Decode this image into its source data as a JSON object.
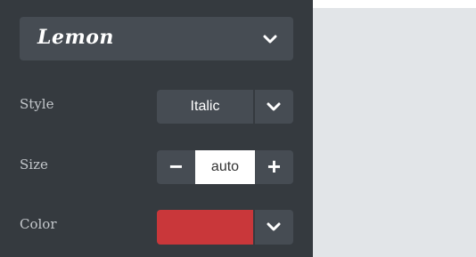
{
  "font_picker": {
    "value": "Lemon",
    "icon": "chevron-down-icon"
  },
  "style": {
    "label": "Style",
    "value": "Italic",
    "icon": "chevron-down-icon"
  },
  "size": {
    "label": "Size",
    "value": "auto",
    "minus": "−",
    "plus": "+"
  },
  "color": {
    "label": "Color",
    "swatch": "#c9373a",
    "icon": "chevron-down-icon"
  },
  "colors": {
    "panel": "#353a3f",
    "control": "#464c53",
    "canvas": "#e2e5e8"
  }
}
